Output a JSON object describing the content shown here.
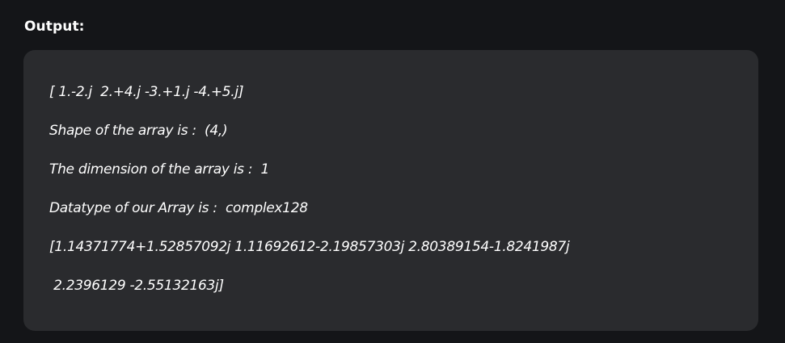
{
  "heading": "Output:",
  "output_lines": [
    "[ 1.-2.j  2.+4.j -3.+1.j -4.+5.j]",
    "Shape of the array is :  (4,)",
    "The dimension of the array is :  1",
    "Datatype of our Array is :  complex128",
    "[1.14371774+1.52857092j 1.11692612-2.19857303j 2.80389154-1.8241987j",
    " 2.2396129 -2.55132163j]"
  ]
}
